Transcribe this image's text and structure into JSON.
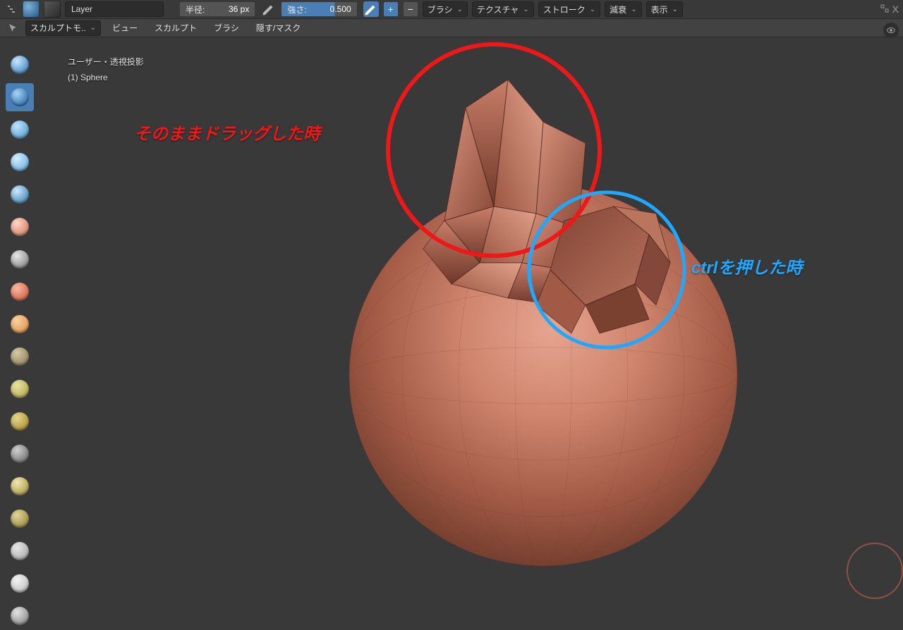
{
  "header": {
    "brush_name": "Layer",
    "radius_label": "半径:",
    "radius_value": "36 px",
    "strength_label": "強さ:",
    "strength_value": "0.500",
    "dropdowns": [
      "ブラシ",
      "テクスチャ",
      "ストローク",
      "減衰",
      "表示"
    ]
  },
  "subheader": {
    "mode": "スカルプトモ..",
    "menus": [
      "ビュー",
      "スカルプト",
      "ブラシ",
      "隠す/マスク"
    ]
  },
  "overlay": {
    "line1": "ユーザー・透視投影",
    "line2": "(1) Sphere"
  },
  "annotations": {
    "red_text": "そのままドラッグした時",
    "blue_text": "ctrlを押した時"
  },
  "corner": {
    "close": "X"
  },
  "tools": [
    {
      "name": "draw",
      "hl": "#c9e6ff",
      "base": "#6aa7d4",
      "dark": "#2e5b82"
    },
    {
      "name": "draw-sharp",
      "hl": "#a8d4f2",
      "base": "#4f8cc2",
      "dark": "#274c73"
    },
    {
      "name": "clay",
      "hl": "#bfe2ff",
      "base": "#78b6de",
      "dark": "#3d6f99"
    },
    {
      "name": "clay-strips",
      "hl": "#d6ecff",
      "base": "#8cc5e8",
      "dark": "#4a7fa6"
    },
    {
      "name": "layer",
      "hl": "#cfe8fb",
      "base": "#6da8cf",
      "dark": "#345f82"
    },
    {
      "name": "inflate",
      "hl": "#ffd6c8",
      "base": "#e69d84",
      "dark": "#a8614a"
    },
    {
      "name": "blob",
      "hl": "#e6e6e6",
      "base": "#a6a6a6",
      "dark": "#6a6a6a"
    },
    {
      "name": "crease",
      "hl": "#ffb7a1",
      "base": "#de7e63",
      "dark": "#9b4c38"
    },
    {
      "name": "smooth",
      "hl": "#ffcf9f",
      "base": "#e6a96a",
      "dark": "#a66f3c"
    },
    {
      "name": "flatten",
      "hl": "#d5c8a6",
      "base": "#a69a74",
      "dark": "#6f6648"
    },
    {
      "name": "fill",
      "hl": "#e9e3a1",
      "base": "#c5bc6a",
      "dark": "#8a8240"
    },
    {
      "name": "scrape",
      "hl": "#e7d58c",
      "base": "#bfa850",
      "dark": "#836f30"
    },
    {
      "name": "pinch",
      "hl": "#d0d0d0",
      "base": "#8f8f8f",
      "dark": "#595959"
    },
    {
      "name": "grab",
      "hl": "#f0e7b0",
      "base": "#c4b36b",
      "dark": "#8a7b41"
    },
    {
      "name": "elastic",
      "hl": "#e0d59a",
      "base": "#b2a35c",
      "dark": "#7a6e3a"
    },
    {
      "name": "snake-hook",
      "hl": "#e6e6e6",
      "base": "#bfbfbf",
      "dark": "#7f7f7f"
    },
    {
      "name": "thumb",
      "hl": "#f2f2f2",
      "base": "#d1d1d1",
      "dark": "#8f8f8f"
    },
    {
      "name": "mask",
      "hl": "#e2e2e2",
      "base": "#a8a8a8",
      "dark": "#6b6b6b"
    }
  ]
}
